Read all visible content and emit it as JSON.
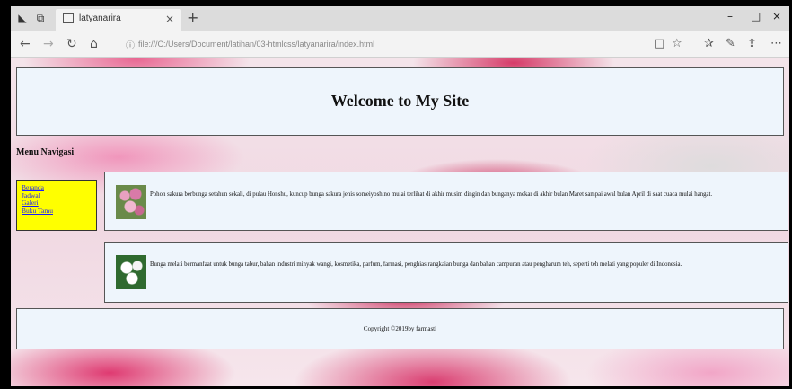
{
  "browser": {
    "tab_title": "latyanarira",
    "tab_close": "×",
    "new_tab": "+",
    "window_controls": {
      "minimize": "–",
      "maximize": "□",
      "close": "×"
    },
    "nav": {
      "back": "←",
      "forward": "→",
      "refresh": "↻",
      "home": "⌂"
    },
    "address": "file:///C:/Users/Document/latihan/03-htmlcss/latyanarira/index.html",
    "tools": {
      "reading_view": "□",
      "favorite": "☆",
      "favorites_hub": "✰",
      "notes": "✎",
      "share": "⇪",
      "more": "⋯"
    }
  },
  "page": {
    "header_title": "Welcome to My Site",
    "menu_title": "Menu Navigasi",
    "menu_items": [
      "Beranda",
      "Jadwal",
      "Galeri",
      "Buku Tamu"
    ],
    "articles": [
      {
        "image": "pink-sakura-flowers",
        "text": "Pohon sakura berbunga setahun sekali, di pulau Honshu, kuncup bunga sakura jenis someiyoshino mulai terlihat di akhir musim dingin dan bunganya mekar di akhir bulan Maret sampai awal bulan April di saat cuaca mulai hangat."
      },
      {
        "image": "white-jasmine-flowers",
        "text": "Bunga melati bermanfaat untuk bunga tabur, bahan industri minyak wangi, kosmetika, parfum, farmasi, penghias rangkaian bunga dan bahan campuran atau pengharum teh, seperti teh melati yang populer di Indonesia."
      }
    ],
    "footer": "Copyright ©2019by farmasti"
  }
}
